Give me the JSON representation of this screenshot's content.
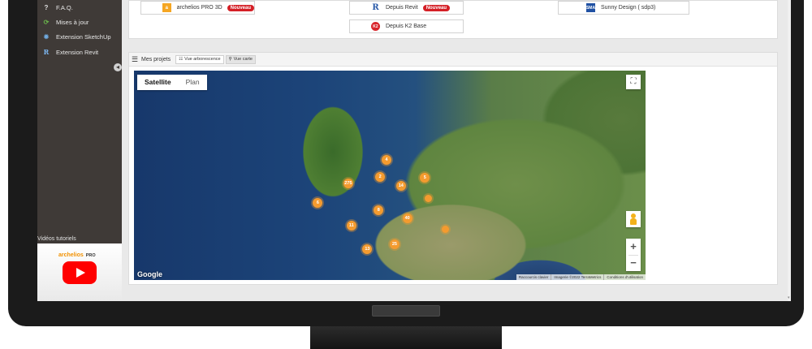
{
  "sidebar": {
    "items": [
      {
        "label": "F.A.Q.",
        "icon": "question-icon",
        "glyph": "?"
      },
      {
        "label": "Mises à jour",
        "icon": "refresh-icon",
        "glyph": "⟳"
      },
      {
        "label": "Extension SketchUp",
        "icon": "sketchup-icon",
        "glyph": "✹"
      },
      {
        "label": "Extension Revit",
        "icon": "revit-icon",
        "glyph": "R"
      }
    ],
    "collapse_glyph": "◂",
    "video_label": "Vidéos tutoriels",
    "video_brand": "archelios",
    "video_brand_suffix": "PRO"
  },
  "software_buttons": [
    {
      "label": "archelios PRO 3D",
      "badge": "Nouveau",
      "icon": "archelios-icon",
      "glyph": "a"
    },
    {
      "label": "Depuis Revit",
      "badge": "Nouveau",
      "icon": "revit-icon",
      "glyph": "R"
    },
    {
      "label": "Sunny Design ( sdp3)",
      "badge": "",
      "icon": "sma-icon",
      "glyph": "SMA"
    },
    {
      "label": "Depuis K2 Base",
      "badge": "",
      "icon": "k2-icon",
      "glyph": "K2"
    }
  ],
  "projects": {
    "title": "Mes projets",
    "views": [
      {
        "label": "Vue arborescence",
        "glyph": "☷",
        "active": false
      },
      {
        "label": "Vue carte",
        "glyph": "⚲",
        "active": true
      }
    ]
  },
  "map": {
    "type_toggle": [
      "Satellite",
      "Plan"
    ],
    "fullscreen_glyph": "⛶",
    "zoom_in": "+",
    "zoom_out": "−",
    "logo": "Google",
    "attribution": [
      "Raccourcis clavier",
      "Imagerie ©2022 TerraMetrics",
      "Conditions d'utilisation"
    ],
    "clusters": [
      {
        "count": "4",
        "lat": 51.3,
        "lon": 2.3
      },
      {
        "count": "2",
        "lat": 49.6,
        "lon": 1.9
      },
      {
        "count": "275",
        "lat": 48.9,
        "lon": -0.1
      },
      {
        "count": "14",
        "lat": 48.7,
        "lon": 3.2
      },
      {
        "count": "5",
        "lat": 49.5,
        "lon": 4.7
      },
      {
        "count": "",
        "lat": 47.4,
        "lon": 4.9
      },
      {
        "count": "6",
        "lat": 47.0,
        "lon": -2.0
      },
      {
        "count": "8",
        "lat": 46.2,
        "lon": 1.8
      },
      {
        "count": "40",
        "lat": 45.4,
        "lon": 3.6
      },
      {
        "count": "11",
        "lat": 44.7,
        "lon": 0.1
      },
      {
        "count": "",
        "lat": 44.3,
        "lon": 6.0
      },
      {
        "count": "25",
        "lat": 42.8,
        "lon": 2.8
      },
      {
        "count": "13",
        "lat": 42.3,
        "lon": 1.1
      }
    ]
  }
}
